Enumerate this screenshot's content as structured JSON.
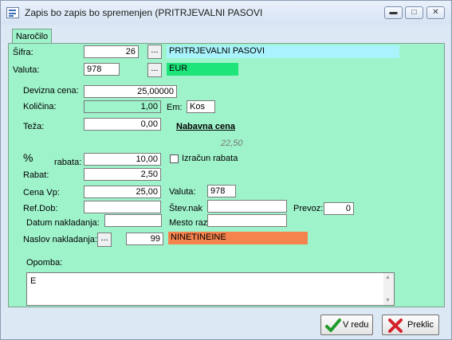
{
  "window": {
    "title": "Zapis bo zapis bo spremenjen  (PRITRJEVALNI PASOVI",
    "controls": {
      "minimize": "minimize-icon",
      "maximize": "maximize-icon",
      "close": "close-icon"
    }
  },
  "tab": {
    "label": "Naročilo"
  },
  "form": {
    "sifra": {
      "label": "Šifra:",
      "value": "26",
      "browse": "...",
      "name": "PRITRJEVALNI PASOVI",
      "name_color": "#a9f3fd"
    },
    "valuta": {
      "label": "Valuta:",
      "value": "978",
      "browse": "...",
      "name": "EUR",
      "name_color": "#1ee57a"
    },
    "devizna_cena": {
      "label": "Devizna cena:",
      "value": "25,00000"
    },
    "kolicina": {
      "label": "Količina:",
      "value": "1,00"
    },
    "em": {
      "label": "Em:",
      "value": "Kos"
    },
    "teza": {
      "label": "Teža:",
      "value": "0,00"
    },
    "nabavna": {
      "label": "Nabavna cena",
      "value": "22,50"
    },
    "rabat_pct": {
      "label_symbol": "%",
      "label": "rabata:",
      "value": "10,00"
    },
    "izracun_rabata": {
      "label": "Izračun rabata",
      "checked": false
    },
    "rabat": {
      "label": "Rabat:",
      "value": "2,50"
    },
    "cena_vp": {
      "label": "Cena Vp:",
      "value": "25,00"
    },
    "valuta2": {
      "label": "Valuta:",
      "value": "978"
    },
    "ref_dob": {
      "label": "Ref.Dob:",
      "value": ""
    },
    "stev_nak": {
      "label": "Štev.nak",
      "value": ""
    },
    "prevoz": {
      "label": "Prevoz:",
      "value": "0"
    },
    "datum_nakladanja": {
      "label": "Datum nakladanja:",
      "value": ""
    },
    "mesto_raz": {
      "label": "Mesto raz:",
      "value": ""
    },
    "naslov_nakladanja": {
      "label": "Naslov nakladanja:",
      "browse": "...",
      "value": "99",
      "name": "NINETINEINE",
      "name_color": "#f5834e"
    },
    "opomba": {
      "label": "Opomba:",
      "value": "E"
    }
  },
  "buttons": {
    "ok": {
      "label": "V redu",
      "icon": "checkmark-icon"
    },
    "cancel": {
      "label": "Preklic",
      "icon": "cross-icon"
    }
  }
}
